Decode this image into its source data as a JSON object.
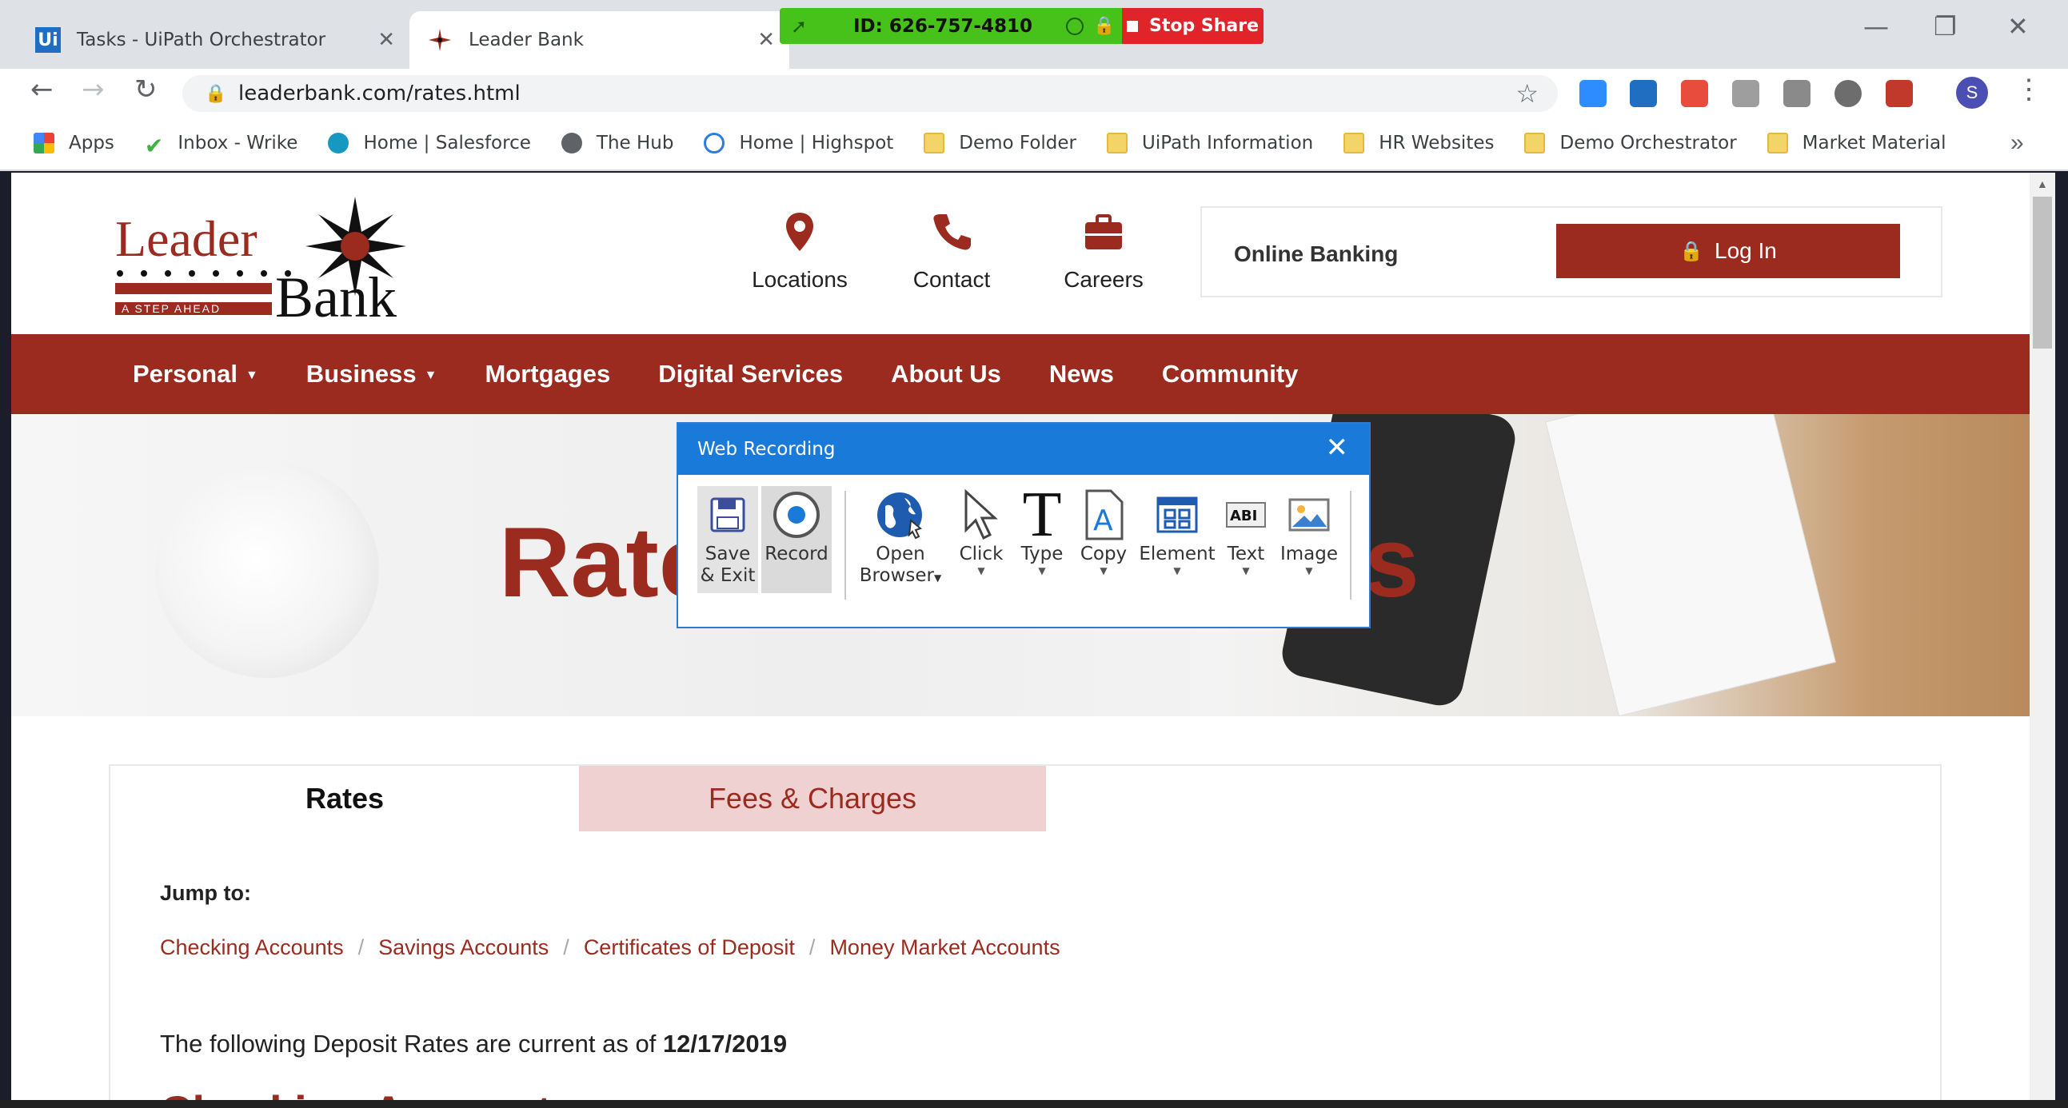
{
  "browser": {
    "tabs": [
      {
        "title": "Tasks - UiPath Orchestrator",
        "favicon": "Ui"
      },
      {
        "title": "Leader Bank"
      }
    ],
    "zoom_share": {
      "id_text": "ID: 626-757-4810",
      "stop_label": "Stop Share"
    },
    "url": "leaderbank.com/rates.html",
    "profile_initial": "S",
    "bookmarks": [
      {
        "label": "Apps",
        "icon": "apps-grid-icon"
      },
      {
        "label": "Inbox - Wrike",
        "icon": "wrike-check-icon"
      },
      {
        "label": "Home | Salesforce",
        "icon": "salesforce-cloud-icon"
      },
      {
        "label": "The Hub",
        "icon": "globe-icon"
      },
      {
        "label": "Home | Highspot",
        "icon": "highspot-icon"
      },
      {
        "label": "Demo Folder",
        "icon": "folder-icon"
      },
      {
        "label": "UiPath Information",
        "icon": "folder-icon"
      },
      {
        "label": "HR Websites",
        "icon": "folder-icon"
      },
      {
        "label": "Demo Orchestrator",
        "icon": "folder-icon"
      },
      {
        "label": "Market Material",
        "icon": "folder-icon"
      }
    ],
    "overflow": "»"
  },
  "site": {
    "logo": {
      "line1": "Leader",
      "line2": "Bank",
      "tagline": "A STEP AHEAD"
    },
    "header_links": [
      {
        "label": "Locations",
        "icon": "map-pin-icon"
      },
      {
        "label": "Contact",
        "icon": "phone-icon"
      },
      {
        "label": "Careers",
        "icon": "briefcase-icon"
      }
    ],
    "online_banking": {
      "label": "Online Banking",
      "login_label": "Log In"
    },
    "nav": [
      "Personal",
      "Business",
      "Mortgages",
      "Digital Services",
      "About Us",
      "News",
      "Community"
    ],
    "hero_title_left": "Rate",
    "hero_title_right": "rges",
    "tabs": {
      "rates": "Rates",
      "fees": "Fees & Charges"
    },
    "jump_label": "Jump to:",
    "jump_links": [
      "Checking Accounts",
      "Savings Accounts",
      "Certificates of Deposit",
      "Money Market Accounts"
    ],
    "rates_note_prefix": "The following Deposit Rates are current as of",
    "rates_date": "12/17/2019",
    "section_heading": "Checking Accounts"
  },
  "dialog": {
    "title": "Web Recording",
    "tools": [
      {
        "label": "Save\n& Exit",
        "line1": "Save",
        "line2": "& Exit",
        "icon": "floppy-disk-icon"
      },
      {
        "label": "Record",
        "icon": "record-icon"
      },
      {
        "line1": "Open",
        "line2": "Browser",
        "icon": "globe-browser-icon"
      },
      {
        "label": "Click",
        "icon": "cursor-icon"
      },
      {
        "label": "Type",
        "icon": "type-t-icon"
      },
      {
        "label": "Copy",
        "icon": "copy-text-icon"
      },
      {
        "label": "Element",
        "icon": "element-icon"
      },
      {
        "label": "Text",
        "icon": "text-abi-icon"
      },
      {
        "label": "Image",
        "icon": "image-icon"
      }
    ]
  },
  "colors": {
    "brand": "#9b2a1f",
    "dialog_blue": "#1a7ad9",
    "zoom_green": "#46c21a",
    "stop_red": "#e0242a"
  }
}
